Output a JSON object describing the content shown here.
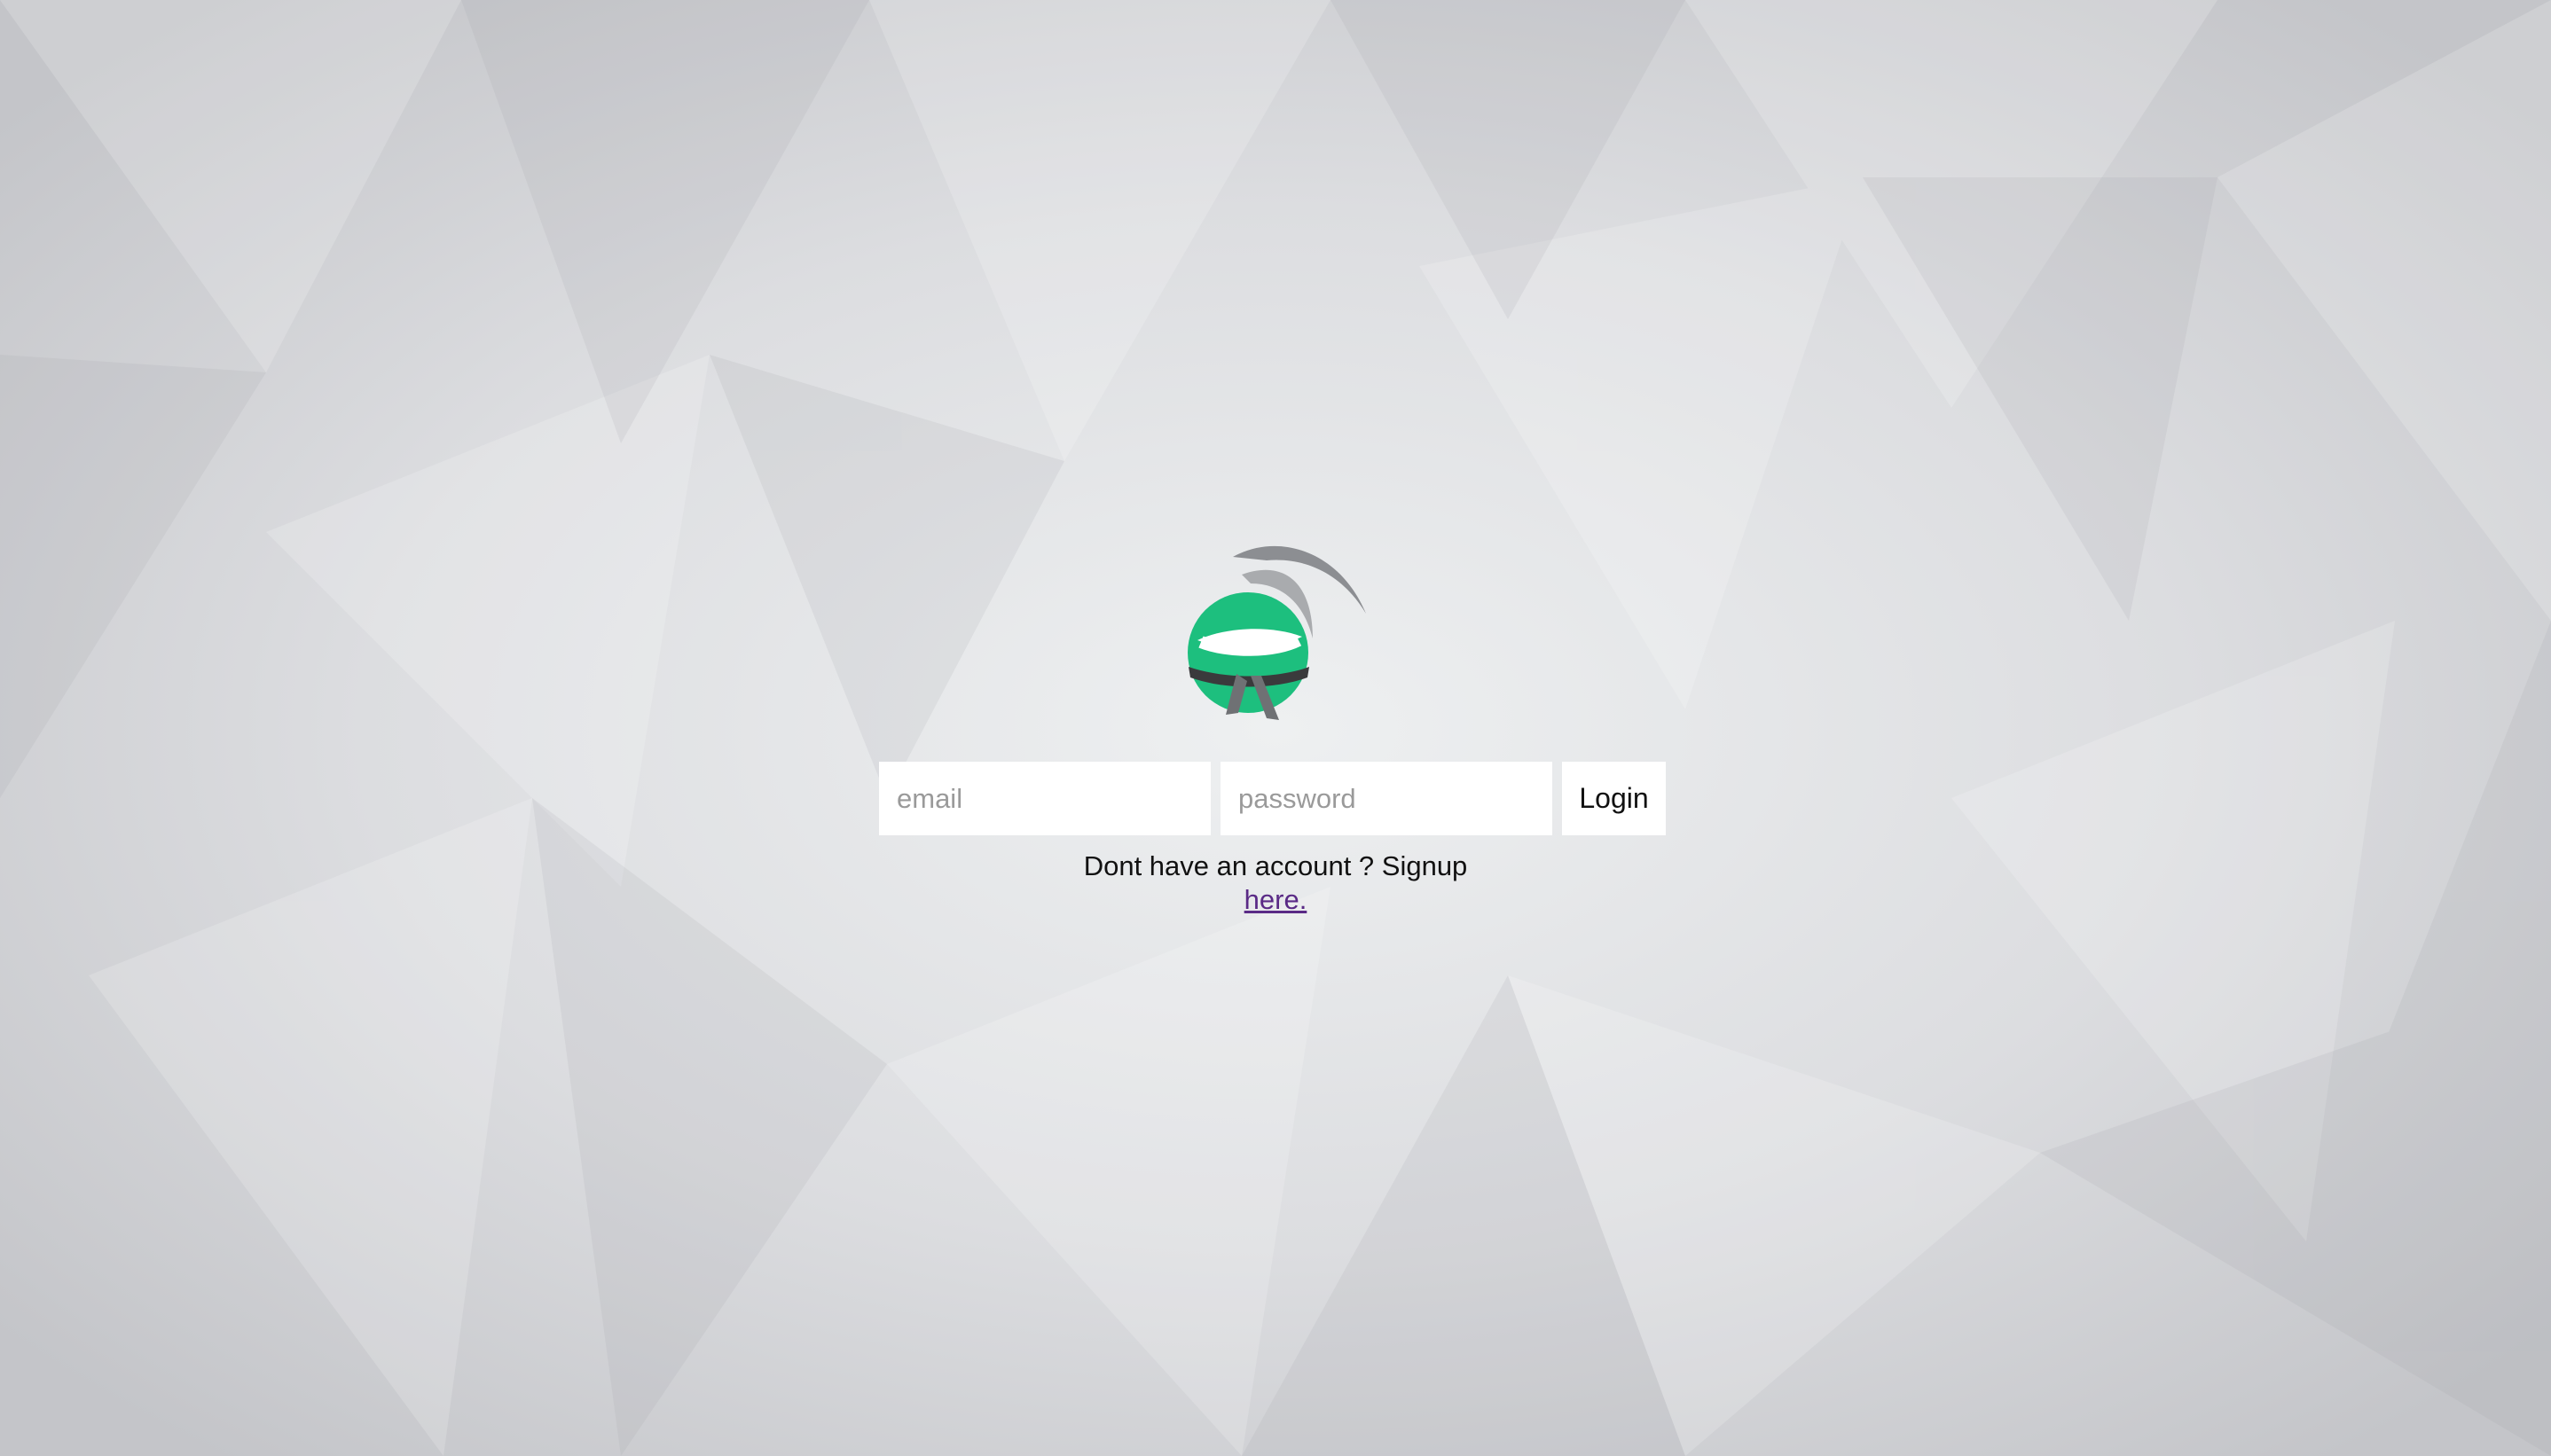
{
  "login": {
    "email_placeholder": "email",
    "password_placeholder": "password",
    "login_label": "Login"
  },
  "signup": {
    "prompt": "Dont have an account ? Signup",
    "link_label": "here."
  },
  "logo": {
    "icon": "ninja-ball-logo",
    "brand_color": "#1dbf7e"
  }
}
